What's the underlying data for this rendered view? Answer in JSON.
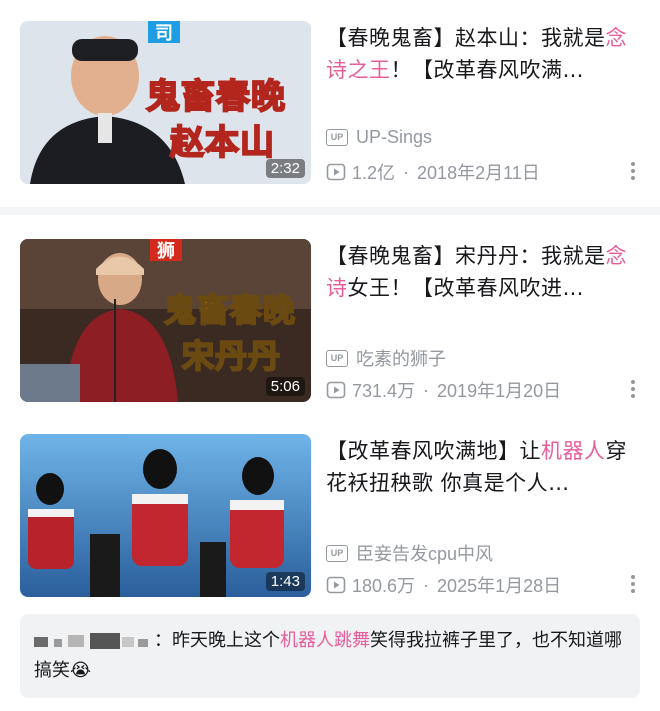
{
  "videos": [
    {
      "title_pre": "【春晚鬼畜】赵本山：我就是",
      "title_hl": "念诗之王",
      "title_post": "！【改革春风吹满…",
      "thumb_text_1": "鬼畜春晚",
      "thumb_text_2": "赵本山",
      "thumb_badge": "司",
      "duration": "2:32",
      "uploader": "UP-Sings",
      "views": "1.2亿",
      "date": "2018年2月11日"
    },
    {
      "title_pre": "【春晚鬼畜】宋丹丹：我就是",
      "title_hl": "念诗",
      "title_post": "女王！【改革春风吹进…",
      "thumb_text_1": "鬼畜春晚",
      "thumb_text_2": "宋丹丹",
      "thumb_badge": "狮",
      "duration": "5:06",
      "uploader": "吃素的狮子",
      "views": "731.4万",
      "date": "2019年1月20日"
    },
    {
      "title_pre": "【改革春风吹满地】让",
      "title_hl": "机器人",
      "title_post": "穿花袄扭秧歌 你真是个人…",
      "duration": "1:43",
      "uploader": "臣妾告发cpu中风",
      "views": "180.6万",
      "date": "2025年1月28日"
    }
  ],
  "comment": {
    "prefix": "：昨天晚上这个",
    "highlight": "机器人跳舞",
    "suffix": "笑得我拉裤子里了，也不知道哪搞笑😭"
  },
  "icons": {
    "up_badge": "UP",
    "separator": "·"
  },
  "colors": {
    "highlight": "#e85e9c",
    "meta": "#9499a0"
  }
}
